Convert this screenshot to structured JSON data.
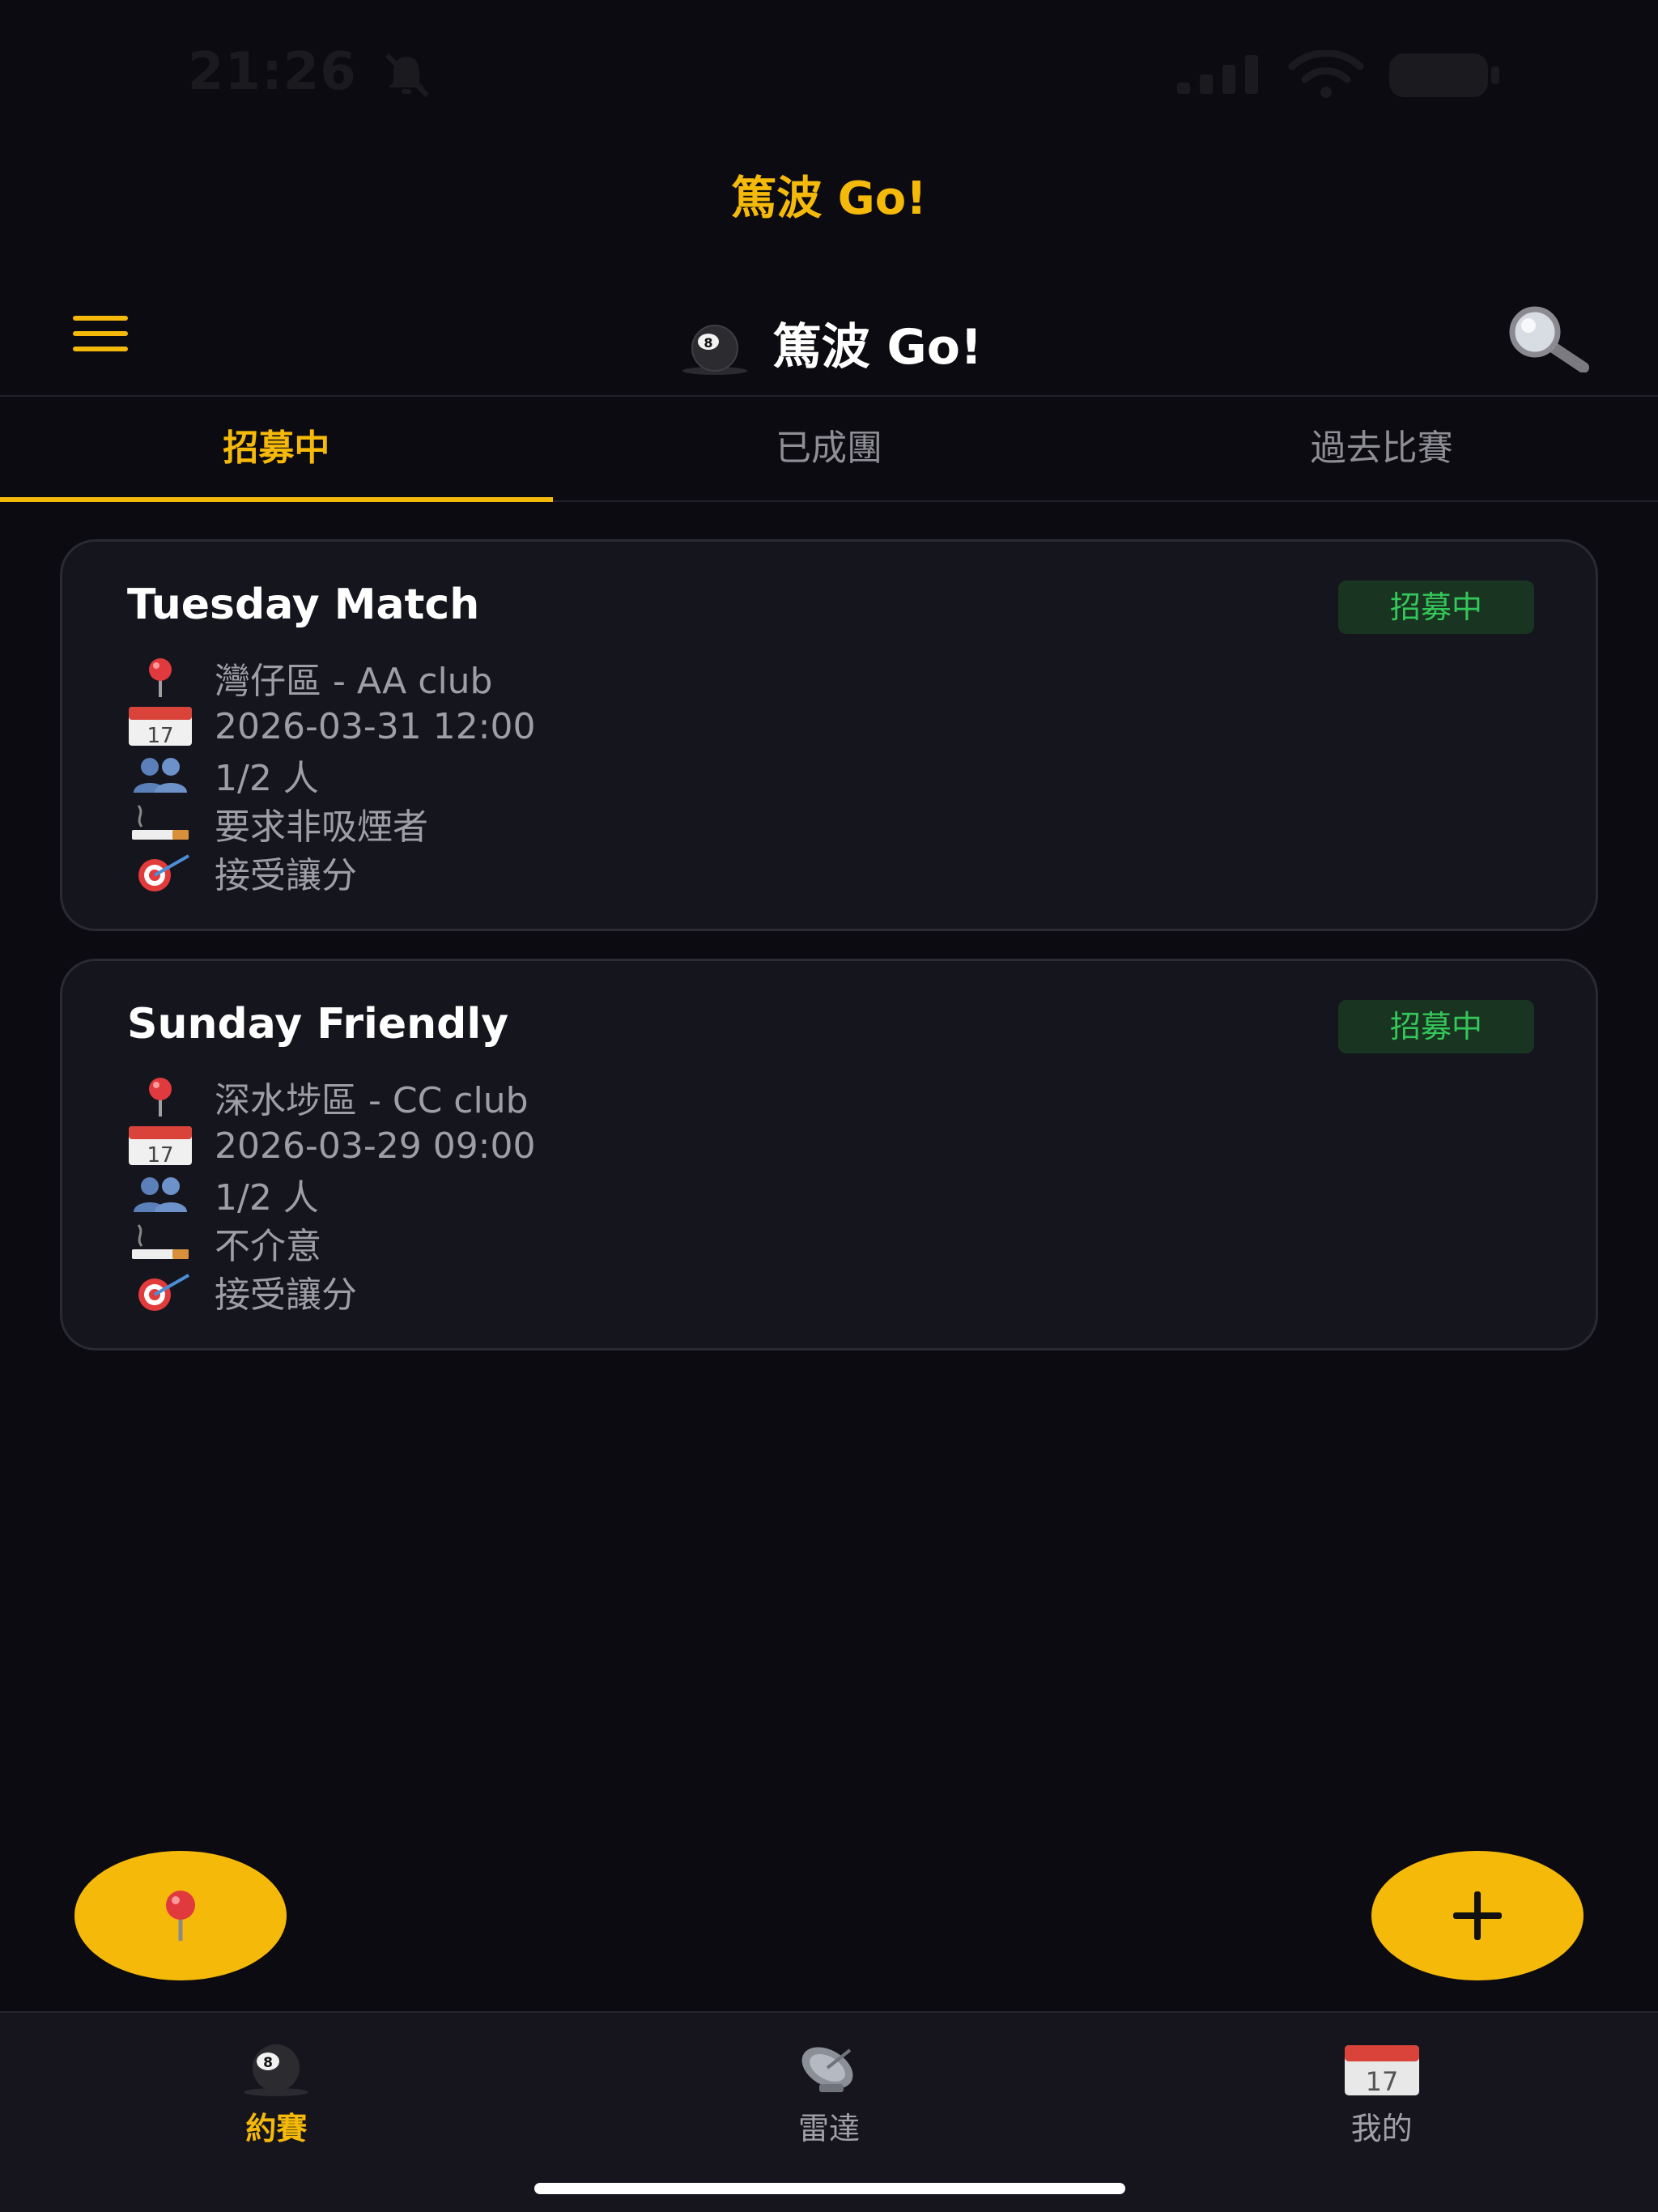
{
  "status_bar": {
    "time": "21:26"
  },
  "app_title": "篤波 Go!",
  "nav": {
    "title": "篤波 Go!"
  },
  "tabs": [
    {
      "label": "招募中",
      "active": true
    },
    {
      "label": "已成團",
      "active": false
    },
    {
      "label": "過去比賽",
      "active": false
    }
  ],
  "cards": [
    {
      "title": "Tuesday Match",
      "status": "招募中",
      "location": "灣仔區 - AA club",
      "datetime": "2026-03-31 12:00",
      "players": "1/2 人",
      "smoking": "要求非吸煙者",
      "handicap": "接受讓分"
    },
    {
      "title": "Sunday Friendly",
      "status": "招募中",
      "location": "深水埗區 - CC club",
      "datetime": "2026-03-29 09:00",
      "players": "1/2 人",
      "smoking": "不介意",
      "handicap": "接受讓分"
    }
  ],
  "calendar_icon_day": "17",
  "tab_bar": [
    {
      "label": "約賽",
      "icon": "eight-ball-icon",
      "active": true
    },
    {
      "label": "雷達",
      "icon": "satellite-dish-icon",
      "active": false
    },
    {
      "label": "我的",
      "icon": "calendar-icon",
      "active": false
    }
  ],
  "colors": {
    "accent": "#f5b90a",
    "background": "#0c0b11",
    "card": "#15151d",
    "badge_text": "#34c759",
    "badge_bg": "#193421"
  }
}
